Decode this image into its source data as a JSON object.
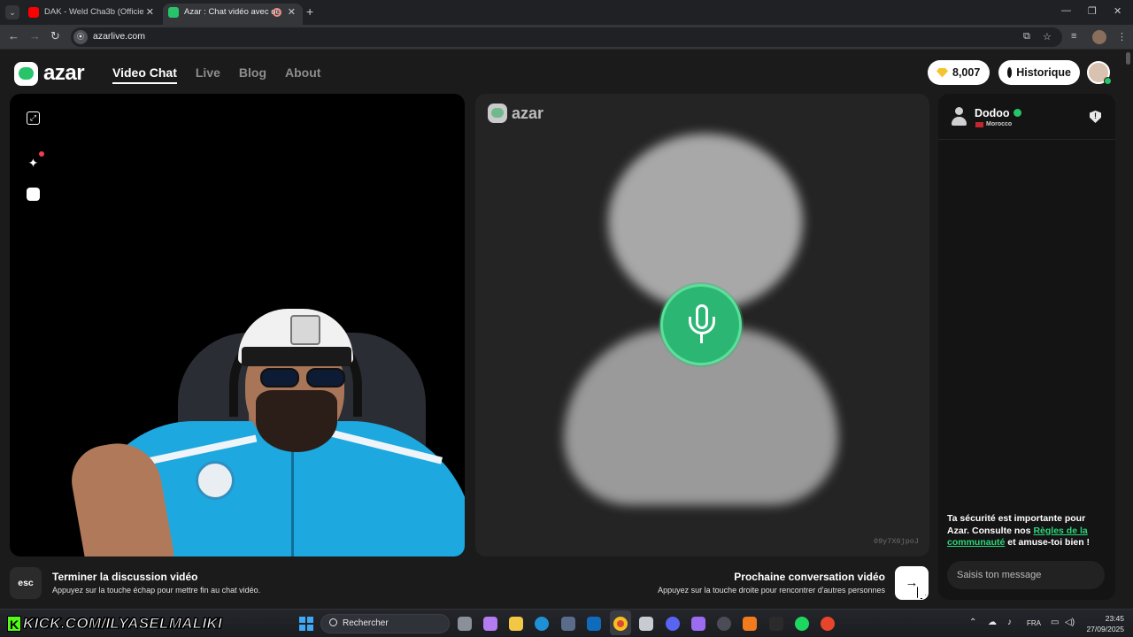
{
  "browser": {
    "tabs": [
      {
        "title": "DAK - Weld Cha3b (Officiel Mu",
        "favicon": "youtube-icon",
        "color": "#ff0000"
      },
      {
        "title": "Azar : Chat vidéo avec de n",
        "favicon": "azar-icon",
        "color": "#27c46a",
        "recording": true
      }
    ],
    "url": "azarlive.com"
  },
  "app": {
    "logo": "azar",
    "nav": [
      "Video Chat",
      "Live",
      "Blog",
      "About"
    ],
    "gems": "8,007",
    "history_label": "Historique"
  },
  "video": {
    "watermark": "azar",
    "session_id": "09y7X6jpoJ"
  },
  "chat": {
    "partner_name": "Dodoo",
    "partner_country": "Morocco",
    "safety_text_1": "Ta sécurité est importante pour Azar. Consulte nos ",
    "safety_link": "Règles de la communauté",
    "safety_text_2": " et amuse-toi bien !",
    "message_placeholder": "Saisis ton message"
  },
  "controls": {
    "esc_key": "esc",
    "end_title": "Terminer la discussion vidéo",
    "end_subtitle": "Appuyez sur la touche échap pour mettre fin au chat vidéo.",
    "next_title": "Prochaine conversation vidéo",
    "next_subtitle": "Appuyez sur la touche droite pour rencontrer d'autres personnes",
    "next_arrow": "→"
  },
  "taskbar": {
    "kick_text": "KICK.COM/ILYASELMALIKI",
    "search_placeholder": "Rechercher",
    "language": "FRA",
    "time": "23:45",
    "date": "27/09/2025"
  },
  "colors": {
    "accent": "#27c46a",
    "link": "#2bd67a"
  }
}
